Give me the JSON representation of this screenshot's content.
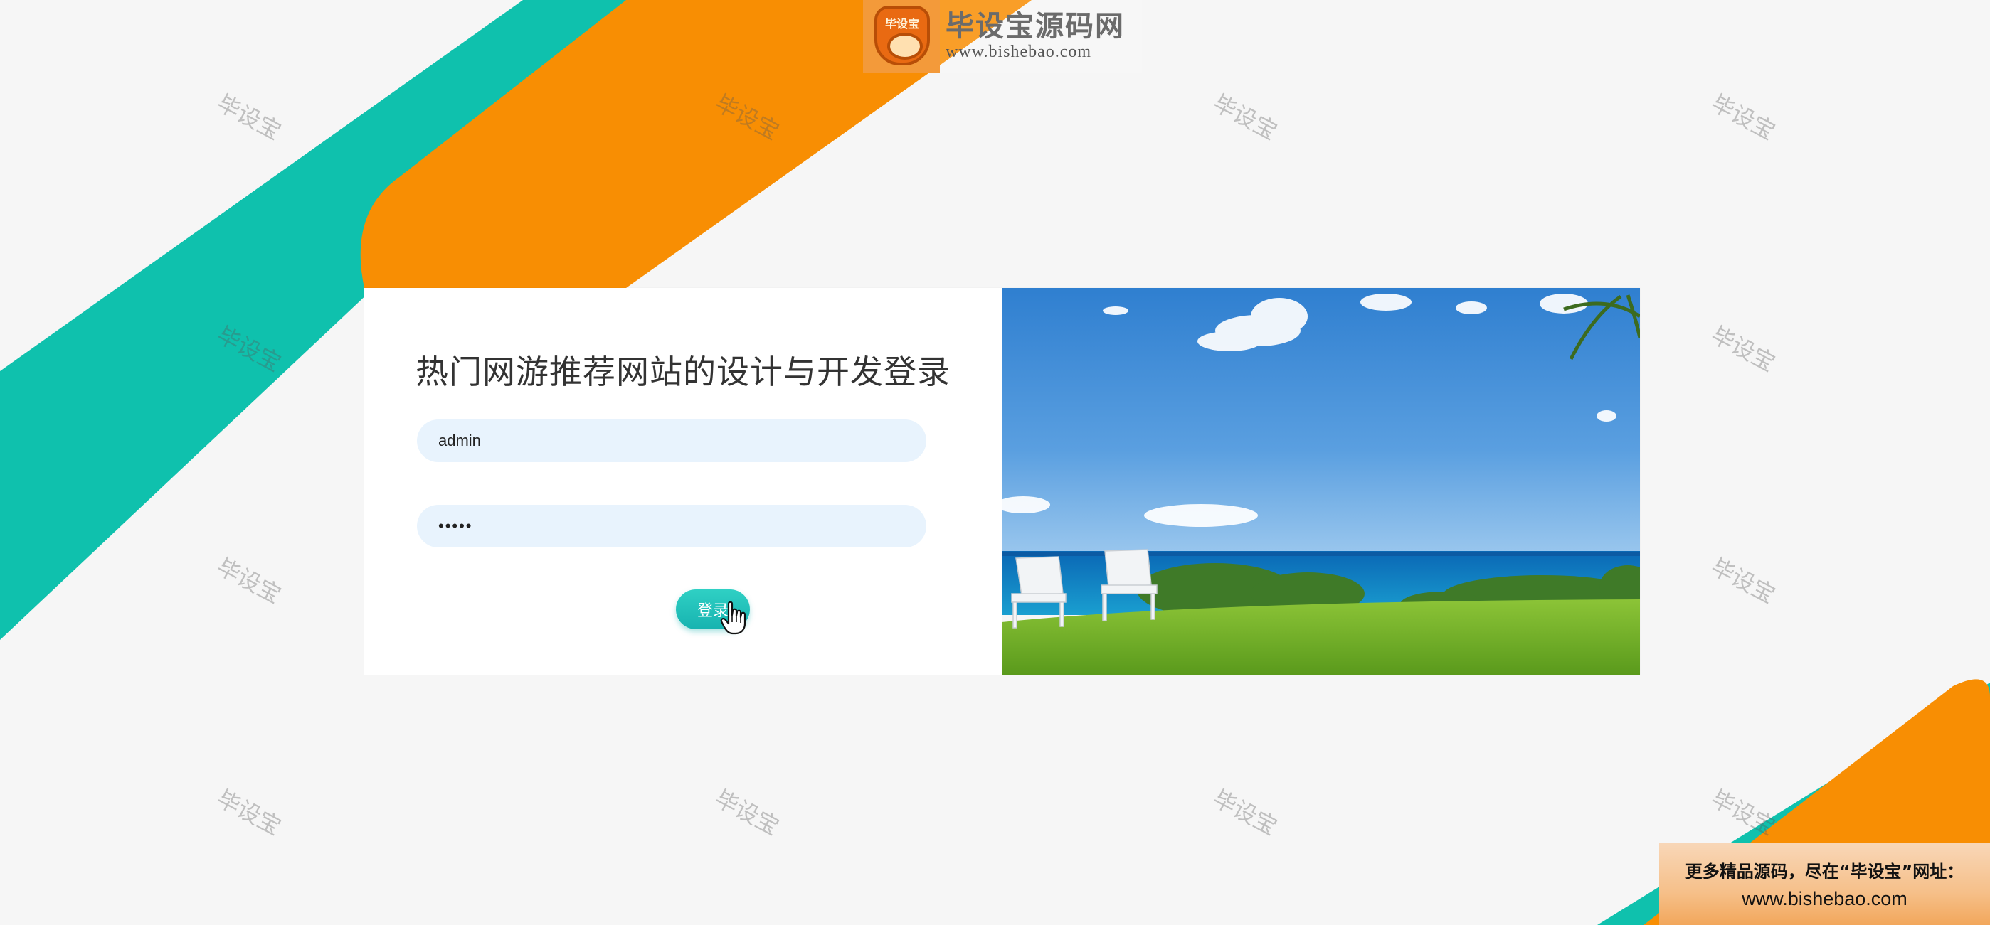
{
  "colors": {
    "teal_stripe": "#0fc1ad",
    "orange_stripe": "#f88e03",
    "background": "#f6f6f6",
    "input_bg": "#e8f3fd",
    "button_teal": "#1dbcb5"
  },
  "logo": {
    "badge_text": "毕设宝",
    "title": "毕设宝源码网",
    "url": "www.bishebao.com"
  },
  "watermark": {
    "text": "毕设宝"
  },
  "login": {
    "title": "热门网游推荐网站的设计与开发登录",
    "username_value": "admin",
    "password_value": "•••••",
    "button_label": "登录"
  },
  "promo": {
    "line1": "更多精品源码，尽在“毕设宝”网址：",
    "line2": "www.bishebao.com"
  }
}
